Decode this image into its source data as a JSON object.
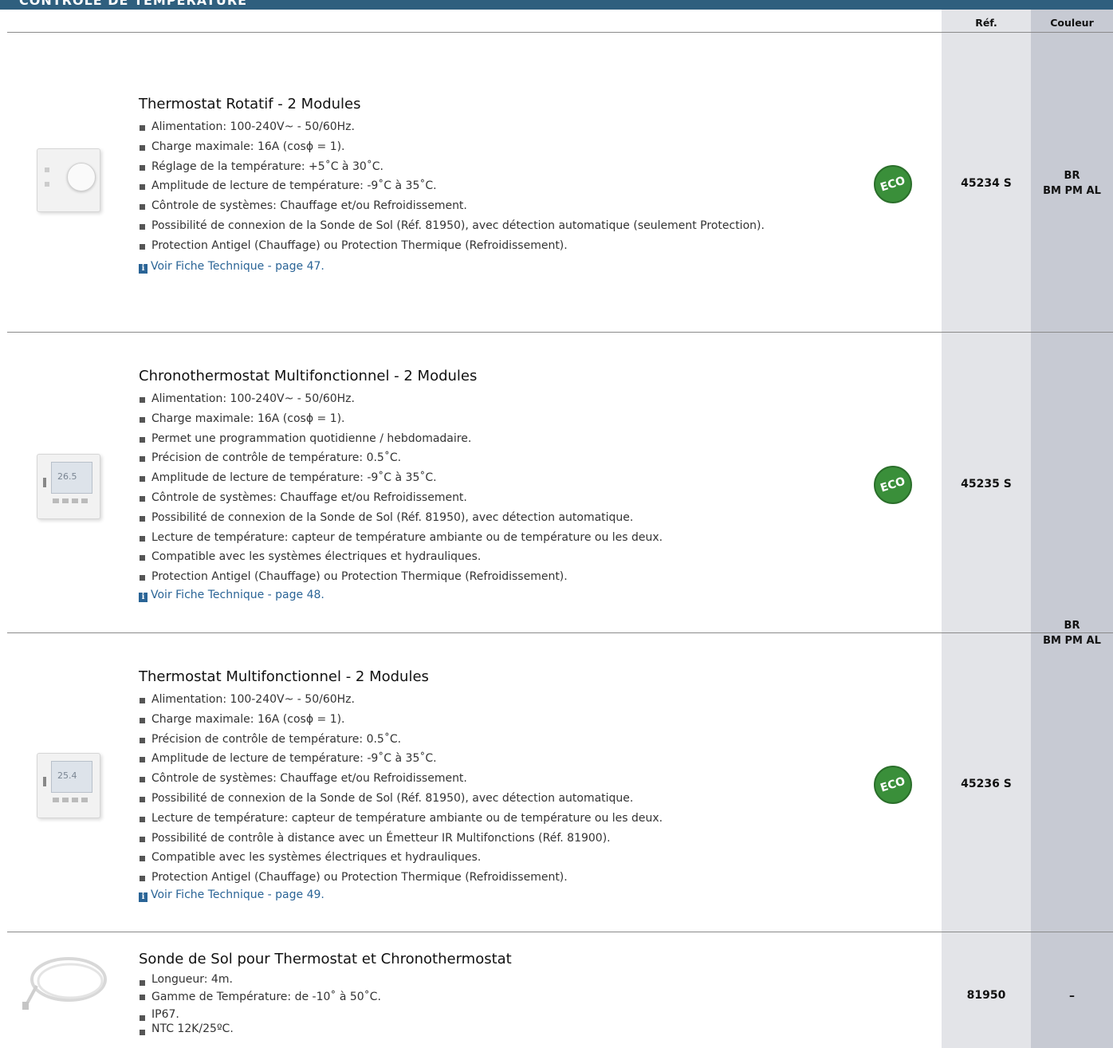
{
  "header": {
    "section_title": "CONTRÔLE DE TEMPÉRATURE",
    "ref_label": "Réf.",
    "color_label": "Couleur"
  },
  "products": [
    {
      "title": "Thermostat Rotatif - 2 Modules",
      "features": [
        "Alimentation: 100-240V~ - 50/60Hz.",
        "Charge maximale: 16A (cosϕ = 1).",
        "Réglage de la température: +5˚C à 30˚C.",
        "Amplitude de lecture de température: -9˚C à 35˚C.",
        "Côntrole de systèmes: Chauffage et/ou Refroidissement.",
        "Possibilité de connexion de la Sonde de Sol (Réf. 81950), avec détection automatique (seulement Protection).",
        "Protection Antigel (Chauffage) ou Protection Thermique (Refroidissement)."
      ],
      "link": "Voir Fiche Technique - page 47.",
      "eco": "ECO",
      "ref": "45234 S",
      "color": [
        "BR",
        "BM PM AL"
      ]
    },
    {
      "title": "Chronothermostat Multifonctionnel - 2 Modules",
      "features": [
        "Alimentation: 100-240V~ - 50/60Hz.",
        "Charge maximale: 16A (cosϕ = 1).",
        "Permet une programmation quotidienne / hebdomadaire.",
        "Précision de contrôle de température: 0.5˚C.",
        "Amplitude de lecture de température: -9˚C à 35˚C.",
        "Côntrole de systèmes: Chauffage et/ou Refroidissement.",
        "Possibilité de connexion de la Sonde de Sol (Réf. 81950), avec détection automatique.",
        "Lecture de température: capteur de température ambiante ou de température ou les deux.",
        "Compatible avec les systèmes électriques et hydrauliques.",
        "Protection Antigel (Chauffage) ou Protection Thermique (Refroidissement)."
      ],
      "link": "Voir Fiche Technique - page 48.",
      "eco": "ECO",
      "ref": "45235 S"
    },
    {
      "title": "Thermostat Multifonctionnel - 2 Modules",
      "features": [
        "Alimentation: 100-240V~ - 50/60Hz.",
        "Charge maximale: 16A (cosϕ = 1).",
        "Précision de contrôle de température: 0.5˚C.",
        "Amplitude de lecture de température: -9˚C à 35˚C.",
        "Côntrole de systèmes: Chauffage et/ou Refroidissement.",
        "Possibilité de connexion de la Sonde de Sol (Réf. 81950), avec détection automatique.",
        "Lecture de température: capteur de température ambiante ou de température ou les deux.",
        "Possibilité de contrôle à distance avec un Émetteur IR Multifonctions (Réf. 81900).",
        "Compatible avec les systèmes électriques et hydrauliques.",
        "Protection Antigel (Chauffage) ou Protection Thermique (Refroidissement)."
      ],
      "link": "Voir Fiche Technique - page 49.",
      "eco": "ECO",
      "ref": "45236 S"
    },
    {
      "title": "Sonde de Sol pour Thermostat et Chronothermostat",
      "features": [
        "Longueur: 4m.",
        "Gamme de Température: de -10˚ à 50˚C.",
        "IP67.",
        "NTC 12K/25ºC."
      ],
      "ref": "81950",
      "color": "–"
    }
  ],
  "shared_color_2_3": [
    "BR",
    "BM PM AL"
  ]
}
